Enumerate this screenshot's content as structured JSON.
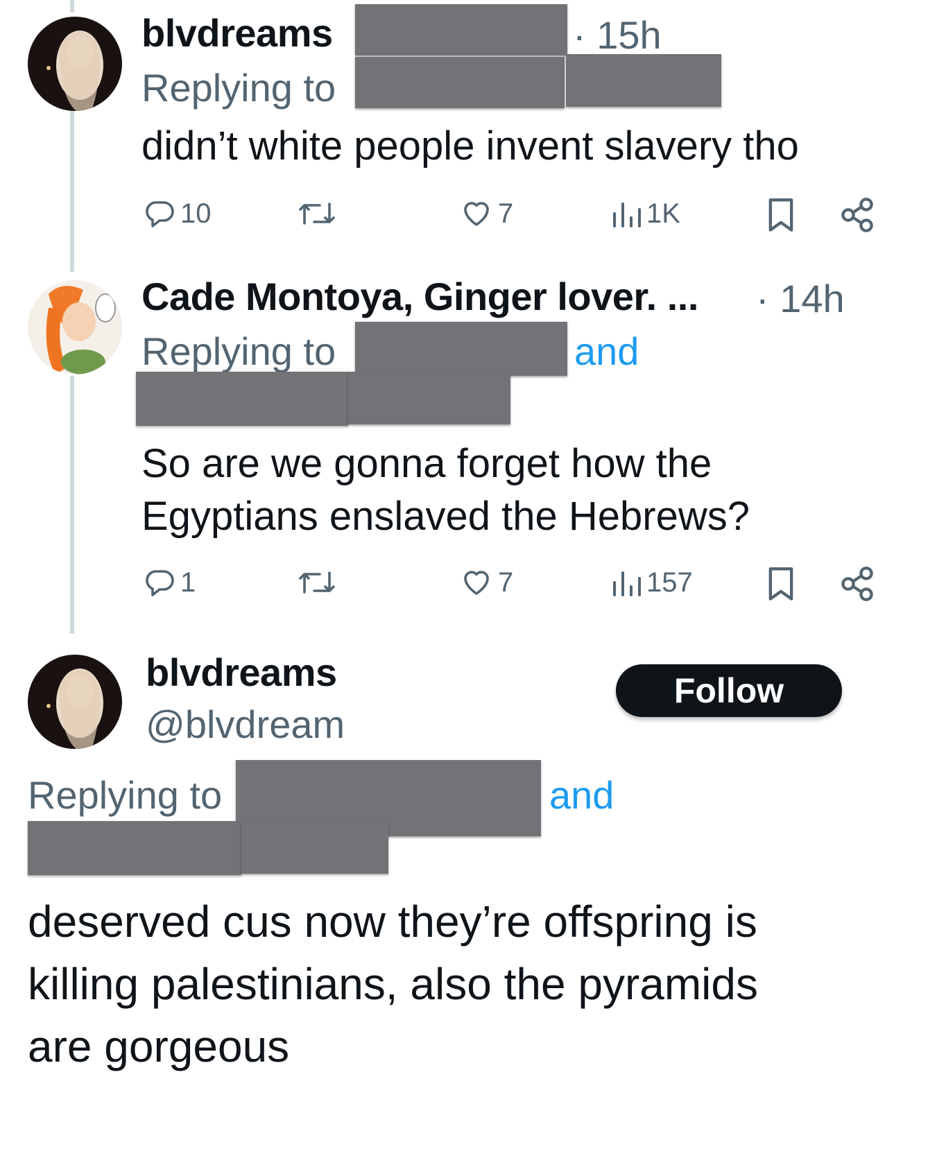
{
  "tweet1": {
    "name": "blvdreams",
    "time": "· 15h",
    "replying_label": "Replying to",
    "text": "didn’t white people invent slavery tho",
    "actions": {
      "replies": "10",
      "likes": "7",
      "views": "1K"
    }
  },
  "tweet2": {
    "name": "Cade Montoya, Ginger lover. ...",
    "time": "· 14h",
    "replying_label": "Replying to",
    "and_label": "and",
    "text_line1": "So are we gonna forget how the",
    "text_line2": "Egyptians enslaved the Hebrews?",
    "actions": {
      "replies": "1",
      "likes": "7",
      "views": "157"
    }
  },
  "tweet3": {
    "name": "blvdreams",
    "handle": "@blvdream",
    "follow_label": "Follow",
    "replying_label": "Replying to",
    "and_label": "and",
    "text_line1": "deserved cus now they’re offspring is",
    "text_line2": "killing palestinians, also the pyramids",
    "text_line3": "are gorgeous"
  },
  "colors": {
    "text": "#0f1419",
    "secondary": "#536471",
    "link": "#1d9bf0",
    "redaction": "#717376",
    "thread_line": "#cfd9de"
  }
}
